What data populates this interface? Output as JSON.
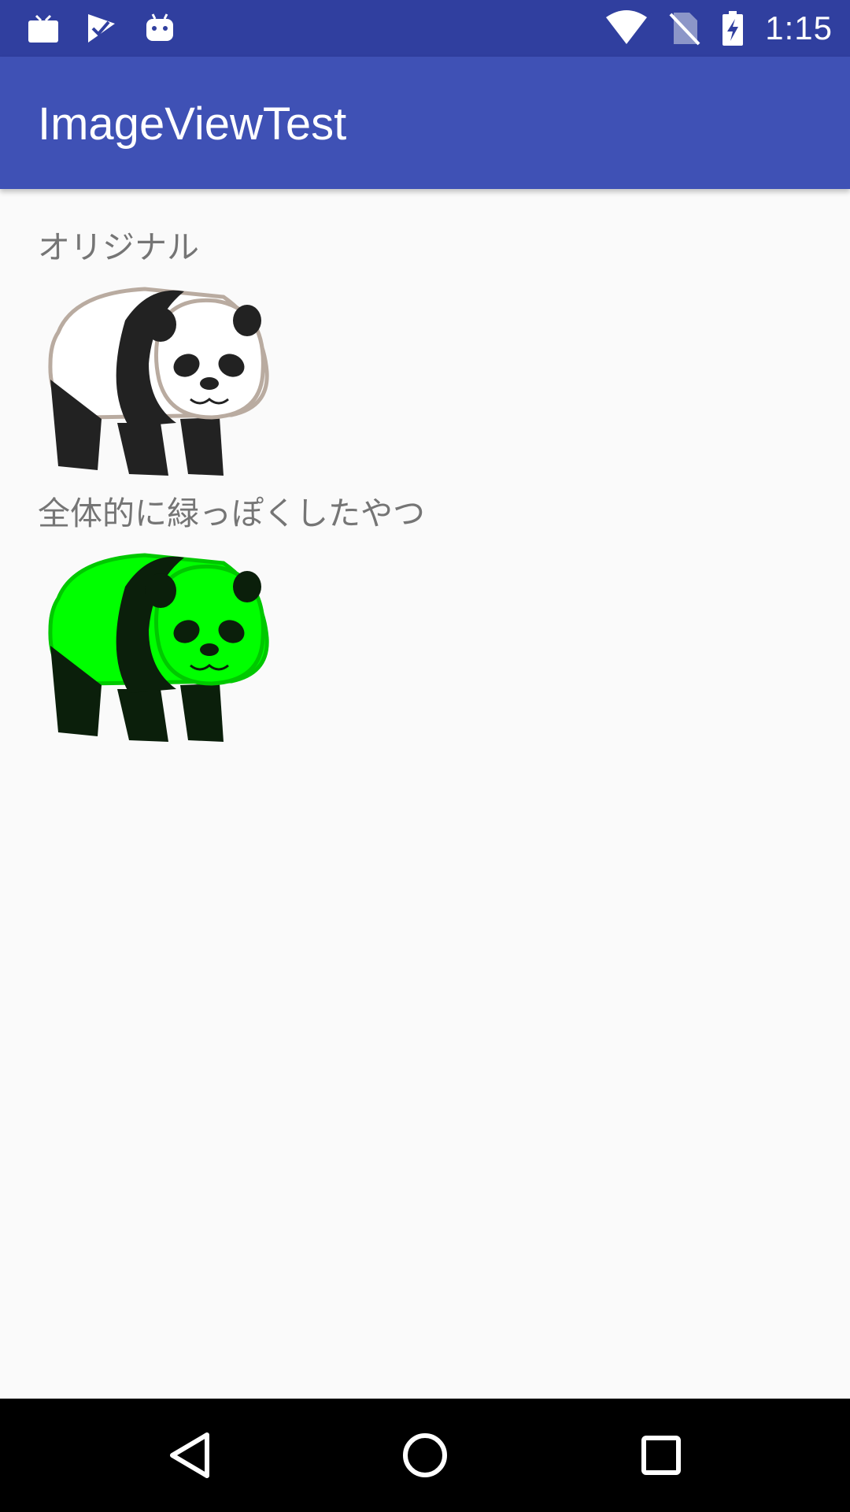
{
  "status_bar": {
    "left_icons": [
      "tv-icon",
      "check-flag-icon",
      "android-icon"
    ],
    "right_icons": [
      "wifi-icon",
      "no-sim-icon",
      "battery-charging-icon"
    ],
    "time": "1:15"
  },
  "app_bar": {
    "title": "ImageViewTest"
  },
  "content": {
    "original_label": "オリジナル",
    "original_image": "panda-original-image",
    "green_label": "全体的に緑っぽくしたやつ",
    "green_image": "panda-green-image"
  },
  "nav_bar": {
    "buttons": [
      "back-icon",
      "home-icon",
      "recents-icon"
    ]
  },
  "colors": {
    "status_bar": "#303f9f",
    "app_bar": "#3f51b5",
    "background": "#fafafa",
    "label_text": "#757575",
    "green_tint": "#00ff00"
  }
}
